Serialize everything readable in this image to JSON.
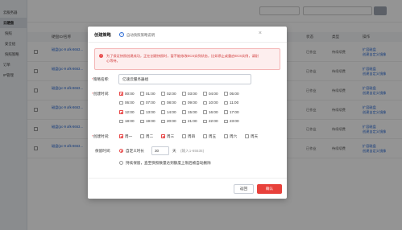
{
  "sidebar": {
    "items": [
      {
        "label": "云服务器"
      },
      {
        "label": "云硬盘"
      },
      {
        "label": "快照"
      },
      {
        "label": "安全组"
      },
      {
        "label": "快照策略"
      },
      {
        "label": "订单"
      },
      {
        "label": "IP管理"
      }
    ]
  },
  "table": {
    "headers": [
      "硬盘ID/名称",
      "状态",
      "类型",
      "操作"
    ],
    "rows": [
      {
        "id": "磁盘(pc-9 afk-8663…",
        "status": "已作业",
        "type": "待续续费",
        "action1": "扩容磁盘",
        "action2": "创建自定义镜像"
      },
      {
        "id": "磁盘(pc-9 afk-8663…",
        "status": "已作业",
        "type": "待续续费",
        "action1": "扩容磁盘",
        "action2": "创建自定义镜像"
      },
      {
        "id": "磁盘(pc-9 afk-8663…",
        "status": "已作业",
        "type": "待续续费",
        "action1": "扩容磁盘",
        "action2": "创建自定义镜像"
      },
      {
        "id": "磁盘(pc-9 afk-8663…",
        "status": "已作业",
        "type": "待续续费",
        "action1": "扩容磁盘",
        "action2": "创建自定义镜像"
      },
      {
        "id": "磁盘(pc-9 afk-8663…",
        "status": "已作业",
        "type": "待续续费",
        "action1": "扩容磁盘",
        "action2": "创建自定义镜像"
      },
      {
        "id": "磁盘(pc-9 afk-8663…",
        "status": "已作业",
        "type": "待续续费",
        "action1": "扩容磁盘",
        "action2": "创建自定义镜像"
      }
    ]
  },
  "modal": {
    "title": "创建策略",
    "help_link": "自动快照策略说明",
    "close_icon": "×",
    "alert_text": "为了保证快照创建成功，正在创建快照时，暂不能修改ECS实例状态，比如停止或重启ECS实例，请耐心等待。",
    "name_label": "策略名称:",
    "name_value": "亿速云服务器组",
    "time_label": "创建时间:",
    "times": [
      {
        "label": "00:00",
        "checked": true
      },
      {
        "label": "01:00",
        "checked": false
      },
      {
        "label": "02:00",
        "checked": false
      },
      {
        "label": "03:00",
        "checked": false
      },
      {
        "label": "04:00",
        "checked": false
      },
      {
        "label": "05:00",
        "checked": false
      },
      {
        "label": "06:00",
        "checked": false
      },
      {
        "label": "07:00",
        "checked": false
      },
      {
        "label": "08:00",
        "checked": false
      },
      {
        "label": "09:00",
        "checked": false
      },
      {
        "label": "10:00",
        "checked": false
      },
      {
        "label": "11:00",
        "checked": false
      },
      {
        "label": "12:00",
        "checked": true
      },
      {
        "label": "13:00",
        "checked": false
      },
      {
        "label": "14:00",
        "checked": false
      },
      {
        "label": "15:00",
        "checked": false
      },
      {
        "label": "16:00",
        "checked": false
      },
      {
        "label": "17:00",
        "checked": false
      },
      {
        "label": "18:00",
        "checked": false
      },
      {
        "label": "19:00",
        "checked": false
      },
      {
        "label": "20:00",
        "checked": false
      },
      {
        "label": "21:00",
        "checked": false
      },
      {
        "label": "22:00",
        "checked": false
      },
      {
        "label": "23:00",
        "checked": false
      }
    ],
    "day_label": "创建时间:",
    "days": [
      {
        "label": "周一",
        "checked": true
      },
      {
        "label": "周二",
        "checked": false
      },
      {
        "label": "周三",
        "checked": true
      },
      {
        "label": "周四",
        "checked": false
      },
      {
        "label": "周五",
        "checked": false
      },
      {
        "label": "周六",
        "checked": false
      },
      {
        "label": "周天",
        "checked": false
      }
    ],
    "retention_label": "保留时间:",
    "retention_custom": "自定义时长",
    "retention_days": "30",
    "retention_unit": "天",
    "retention_hint": "(输入1-65535)",
    "retention_forever": "持续保留，直至快照数量达到额度上限后被自动删除",
    "back_button": "返回",
    "ok_button": "确认"
  },
  "colors": {
    "accent": "#e8413b",
    "alert_bg": "#fdeeee",
    "link": "#2b6bd6"
  }
}
